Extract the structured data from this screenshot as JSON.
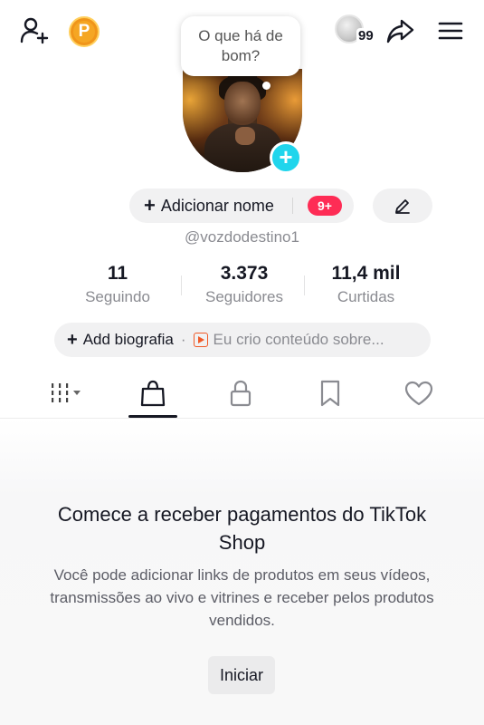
{
  "bubble": {
    "text": "O que há de bom?"
  },
  "topbar": {
    "viewers_count": "99",
    "coin_letter": "P"
  },
  "profile": {
    "add_name_label": "Adicionar nome",
    "notifications_badge": "9+",
    "username": "@vozdodestino1"
  },
  "stats": [
    {
      "value": "11",
      "label": "Seguindo"
    },
    {
      "value": "3.373",
      "label": "Seguidores"
    },
    {
      "value": "11,4 mil",
      "label": "Curtidas"
    }
  ],
  "bio": {
    "add_label": "Add biografia",
    "suggestion": "Eu crio conteúdo sobre..."
  },
  "tabs": [
    "videos",
    "shop",
    "private",
    "favorites",
    "liked"
  ],
  "shop_cta": {
    "title": "Comece a receber pagamentos do TikTok Shop",
    "description": "Você pode adicionar links de produtos em seus vídeos, transmissões ao vivo e vitrines e receber pelos produtos vendidos.",
    "button": "Iniciar"
  },
  "colors": {
    "accent_red": "#fe2c55",
    "accent_cyan": "#20d5ec",
    "coin": "#f5a623",
    "text_secondary": "#8a8b91"
  }
}
